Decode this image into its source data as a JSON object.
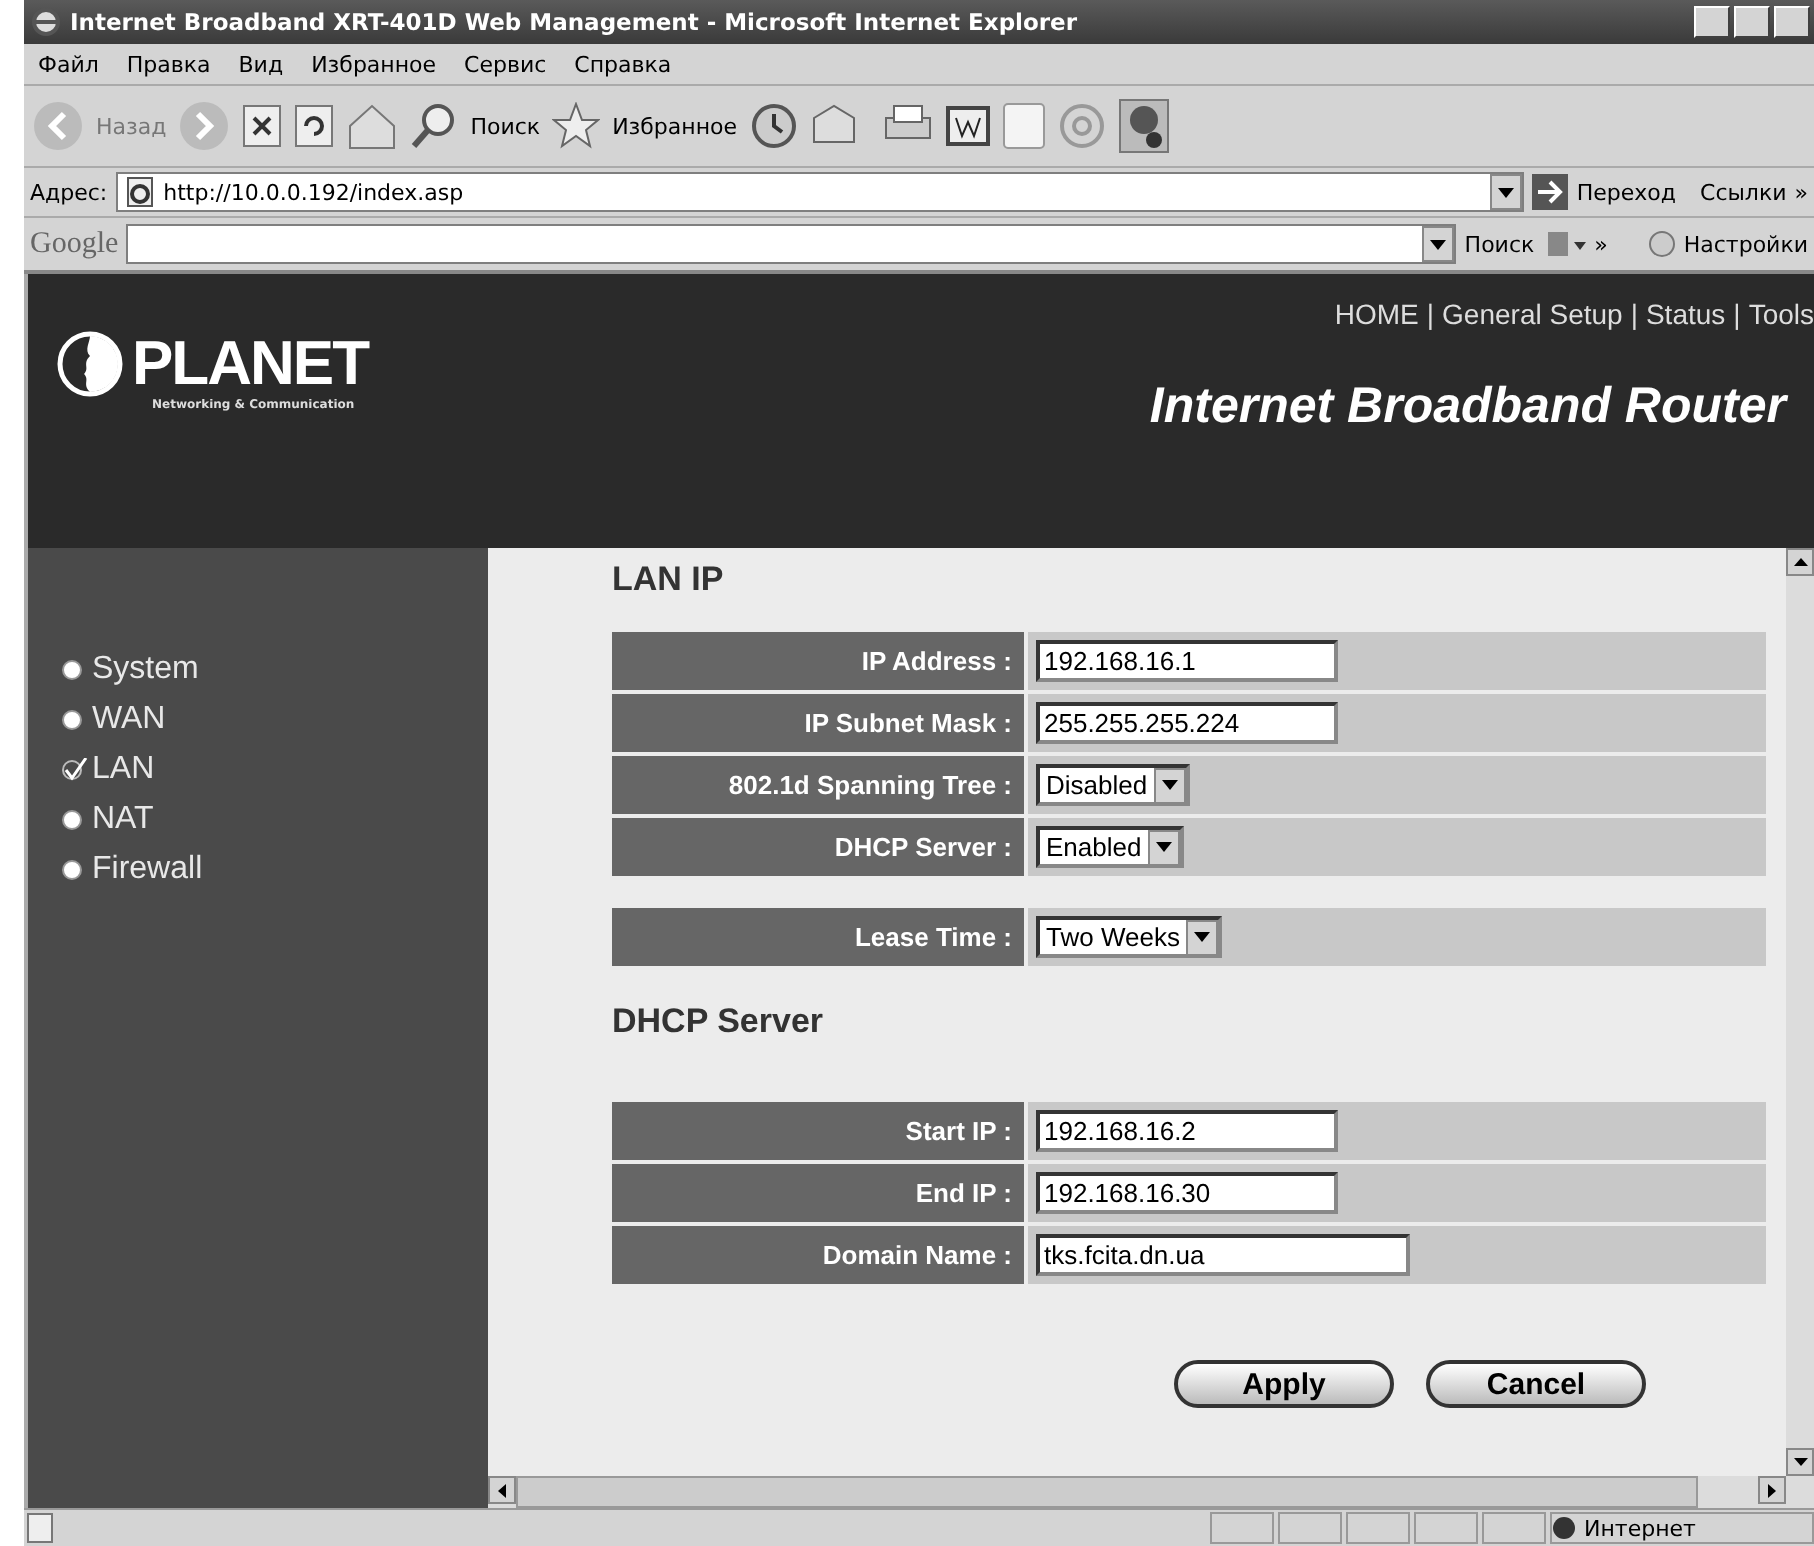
{
  "window": {
    "title": "Internet Broadband XRT-401D Web Management - Microsoft Internet Explorer"
  },
  "menu": [
    "Файл",
    "Правка",
    "Вид",
    "Избранное",
    "Сервис",
    "Справка"
  ],
  "toolbar": {
    "back": "Назад",
    "search": "Поиск",
    "favorites": "Избранное"
  },
  "address_bar": {
    "label": "Адрес:",
    "url": "http://10.0.0.192/index.asp",
    "go": "Переход",
    "links": "Ссылки",
    "more": "»"
  },
  "google_bar": {
    "logo": "Google",
    "search": "Поиск",
    "more": "»",
    "settings": "Настройки"
  },
  "header": {
    "logo": "PLANET",
    "tagline": "Networking & Communication",
    "nav": [
      "HOME",
      "General Setup",
      "Status",
      "Tools"
    ],
    "separator": "|",
    "title": "Internet Broadband Router"
  },
  "sidebar": [
    {
      "label": "System",
      "selected": false
    },
    {
      "label": "WAN",
      "selected": false
    },
    {
      "label": "LAN",
      "selected": true
    },
    {
      "label": "NAT",
      "selected": false
    },
    {
      "label": "Firewall",
      "selected": false
    }
  ],
  "sections": [
    {
      "heading": "LAN IP",
      "tables": [
        [
          {
            "label": "IP Address :",
            "kind": "text",
            "value": "192.168.16.1"
          },
          {
            "label": "IP Subnet Mask :",
            "kind": "text",
            "value": "255.255.255.224"
          },
          {
            "label": "802.1d Spanning Tree :",
            "kind": "select",
            "value": "Disabled"
          },
          {
            "label": "DHCP Server :",
            "kind": "select",
            "value": "Enabled"
          }
        ],
        [
          {
            "label": "Lease Time :",
            "kind": "select",
            "value": "Two Weeks"
          }
        ]
      ]
    },
    {
      "heading": "DHCP Server",
      "tables": [
        [
          {
            "label": "Start IP :",
            "kind": "text",
            "value": "192.168.16.2"
          },
          {
            "label": "End IP :",
            "kind": "text",
            "value": "192.168.16.30"
          },
          {
            "label": "Domain Name :",
            "kind": "wide",
            "value": "tks.fcita.dn.ua"
          }
        ]
      ]
    }
  ],
  "buttons": [
    "Apply",
    "Cancel"
  ],
  "status_bar": {
    "zone": "Интернет"
  }
}
